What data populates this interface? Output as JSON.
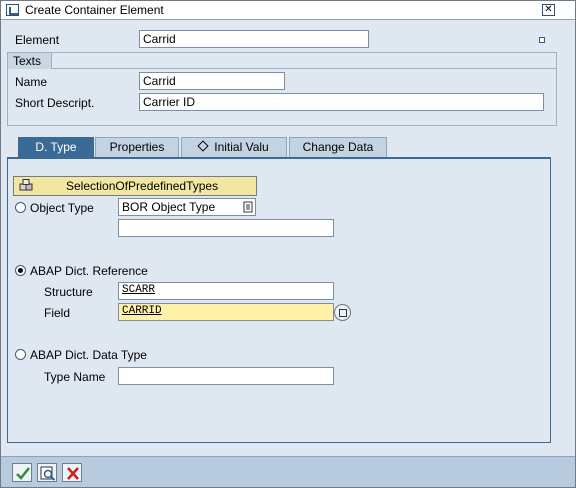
{
  "window": {
    "title": "Create Container Element"
  },
  "element": {
    "label": "Element",
    "value": "Carrid"
  },
  "texts": {
    "section_label": "Texts",
    "name_label": "Name",
    "name_value": "Carrid",
    "short_desc_label": "Short Descript.",
    "short_desc_value": "Carrier ID"
  },
  "tabs": [
    {
      "label": "D. Type",
      "active": true
    },
    {
      "label": "Properties",
      "active": false
    },
    {
      "label": "Initial Valu",
      "active": false
    },
    {
      "label": "Change Data",
      "active": false
    }
  ],
  "dtype": {
    "predefined_button": "SelectionOfPredefinedTypes",
    "object_type": {
      "label": "Object Type",
      "selected": false,
      "value": "BOR Object Type",
      "extra_value": ""
    },
    "abap_ref": {
      "label": "ABAP Dict. Reference",
      "selected": true,
      "structure_label": "Structure",
      "structure_value": "SCARR",
      "field_label": "Field",
      "field_value": "CARRID"
    },
    "abap_data_type": {
      "label": "ABAP Dict. Data Type",
      "selected": false,
      "type_name_label": "Type Name",
      "type_name_value": ""
    }
  },
  "toolbar": {
    "buttons": [
      "confirm-icon",
      "check-icon",
      "cancel-icon"
    ]
  },
  "colors": {
    "accent": "#3a6b97",
    "panel": "#dfe8f1",
    "highlight": "#fff2a8",
    "button_yellow": "#f2e6a0"
  }
}
